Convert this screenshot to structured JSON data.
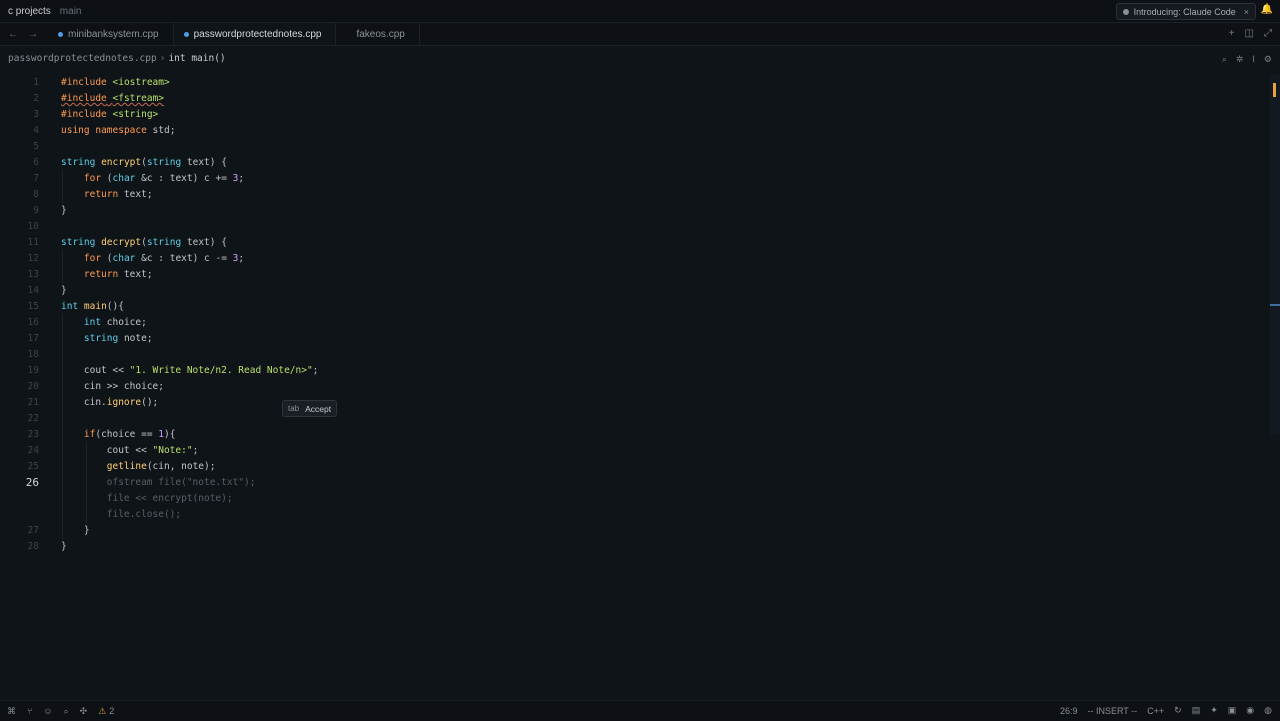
{
  "titlebar": {
    "project": "c projects",
    "branch": "main",
    "notice": "Introducing: Claude Code",
    "notice_close": "×",
    "bell_icon": "bell-icon"
  },
  "tabs": [
    {
      "label": "minibanksystem.cpp",
      "modified": true,
      "active": false
    },
    {
      "label": "passwordprotectednotes.cpp",
      "modified": true,
      "active": true
    },
    {
      "label": "fakeos.cpp",
      "modified": false,
      "active": false
    }
  ],
  "nav": {
    "back": "←",
    "forward": "→"
  },
  "tab_actions": {
    "add": "+",
    "split": "◫",
    "expand": "⤢"
  },
  "breadcrumb": {
    "file": "passwordprotectednotes.cpp",
    "separator": "›",
    "symbol": "int main()"
  },
  "editor": {
    "current_line": 26,
    "accept_hint": {
      "key": "tab",
      "label": "Accept"
    },
    "lines": [
      {
        "n": "1",
        "code": "#include <iostream>"
      },
      {
        "n": "2",
        "code": "#include <fstream>"
      },
      {
        "n": "3",
        "code": "#include <string>"
      },
      {
        "n": "4",
        "code": "using namespace std;"
      },
      {
        "n": "5",
        "code": ""
      },
      {
        "n": "6",
        "code": "string encrypt(string text) {"
      },
      {
        "n": "7",
        "code": "    for (char &c : text) c += 3;"
      },
      {
        "n": "8",
        "code": "    return text;"
      },
      {
        "n": "9",
        "code": "}"
      },
      {
        "n": "10",
        "code": ""
      },
      {
        "n": "11",
        "code": "string decrypt(string text) {"
      },
      {
        "n": "12",
        "code": "    for (char &c : text) c -= 3;"
      },
      {
        "n": "13",
        "code": "    return text;"
      },
      {
        "n": "14",
        "code": "}"
      },
      {
        "n": "15",
        "code": "int main(){"
      },
      {
        "n": "16",
        "code": "    int choice;"
      },
      {
        "n": "17",
        "code": "    string note;"
      },
      {
        "n": "18",
        "code": ""
      },
      {
        "n": "19",
        "code": "    cout << \"1. Write Note/n2. Read Note/n>\";"
      },
      {
        "n": "20",
        "code": "    cin >> choice;"
      },
      {
        "n": "21",
        "code": "    cin.ignore();"
      },
      {
        "n": "22",
        "code": ""
      },
      {
        "n": "23",
        "code": "    if(choice == 1){"
      },
      {
        "n": "24",
        "code": "        cout << \"Note:\";"
      },
      {
        "n": "25",
        "code": "        getline(cin, note);"
      },
      {
        "n": "26",
        "code": "        ofstream file(\"note.txt\");"
      },
      {
        "n": "",
        "code": "        file << encrypt(note);"
      },
      {
        "n": "",
        "code": "        file.close();"
      },
      {
        "n": "27",
        "code": "    }"
      },
      {
        "n": "28",
        "code": "}"
      }
    ]
  },
  "statusbar": {
    "warnings": "2",
    "cursor": "26:9",
    "mode": "-- INSERT --",
    "language": "C++"
  },
  "colors": {
    "background": "#0f1419",
    "accent": "#4c9ee8",
    "keyword": "#ff9a4d",
    "type": "#5ccfe6",
    "function": "#ffd173",
    "string": "#b8e06b",
    "warning": "#d9a441"
  }
}
